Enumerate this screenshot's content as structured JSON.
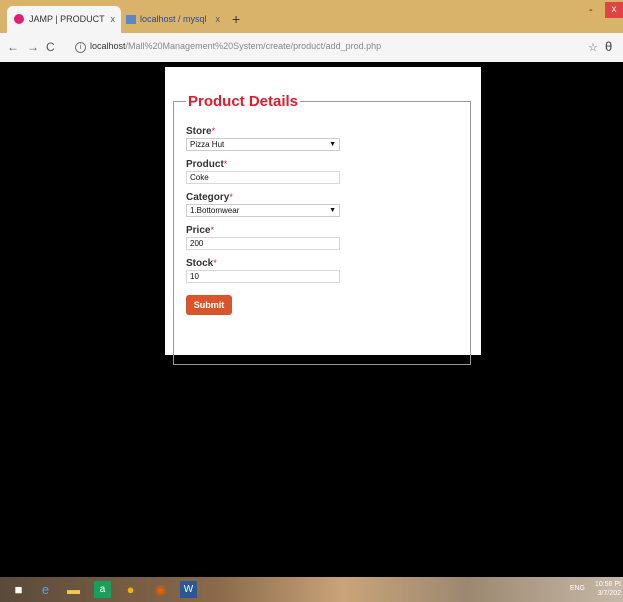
{
  "browser": {
    "tabs": [
      {
        "title": "JAMP | PRODUCT",
        "close": "x"
      },
      {
        "title": "localhost / mysql wampserver /",
        "close": "x"
      }
    ],
    "new_tab": "+",
    "url_host": "localhost",
    "url_path": "/Mall%20Management%20System/create/product/add_prod.php",
    "window_min": "-",
    "window_close": "x"
  },
  "form": {
    "legend": "Product Details",
    "required_mark": "*",
    "store": {
      "label": "Store",
      "value": "Pizza Hut"
    },
    "product": {
      "label": "Product",
      "value": "Coke"
    },
    "category": {
      "label": "Category",
      "value": "1.Bottomwear"
    },
    "price": {
      "label": "Price",
      "value": "200"
    },
    "stock": {
      "label": "Stock",
      "value": "10"
    },
    "submit_label": "Submit"
  },
  "taskbar": {
    "icons": [
      "windows-start-icon",
      "edge-icon",
      "file-explorer-icon",
      "store-icon",
      "chrome-icon",
      "firefox-icon",
      "word-icon"
    ],
    "language": "ENG",
    "time": "10:56 PI",
    "date": "3/7/202"
  }
}
